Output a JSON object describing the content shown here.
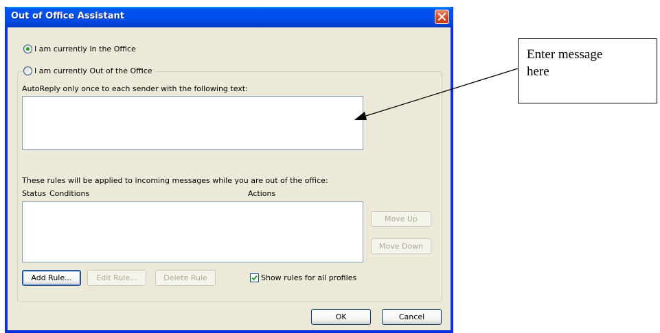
{
  "window": {
    "title": "Out of Office Assistant"
  },
  "status": {
    "in_office_label": "I am currently In the Office",
    "out_office_label": "I am currently Out of the Office",
    "selected": "in_office"
  },
  "autoreply": {
    "label": "AutoReply only once to each sender with the following text:",
    "value": ""
  },
  "rules": {
    "description": "These rules will be applied to incoming messages while you are out of the office:",
    "columns": [
      "Status",
      "Conditions",
      "Actions"
    ],
    "rows": [],
    "move_up_label": "Move Up",
    "move_down_label": "Move Down",
    "add_rule_label": "Add Rule...",
    "edit_rule_label": "Edit Rule...",
    "delete_rule_label": "Delete Rule",
    "show_all_profiles_label": "Show rules for all profiles",
    "show_all_profiles_checked": true
  },
  "footer": {
    "ok_label": "OK",
    "cancel_label": "Cancel"
  },
  "annotation": {
    "text_line1": "Enter message",
    "text_line2": "here"
  },
  "colors": {
    "titlebar": "#0054e3",
    "dialog_bg": "#ece9d8",
    "close_button": "#d2461f",
    "radio_dot": "#21a121",
    "checkmark": "#21a121"
  }
}
